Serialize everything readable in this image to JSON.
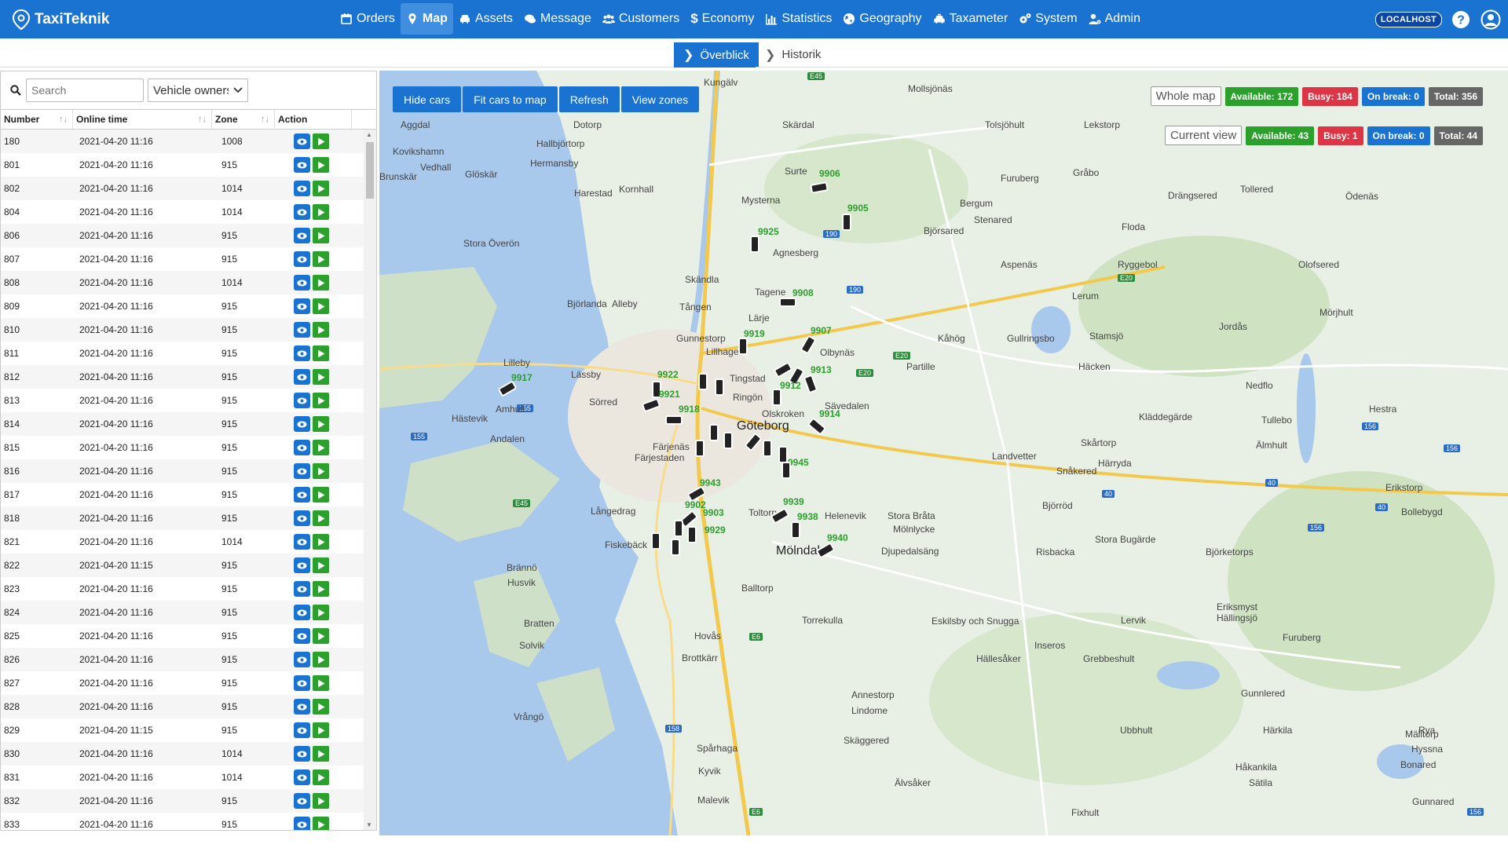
{
  "nav": {
    "brand": "TaxiTeknik",
    "items": [
      {
        "label": "Orders",
        "icon": "calendar-icon",
        "active": false
      },
      {
        "label": "Map",
        "icon": "map-pin-icon",
        "active": true
      },
      {
        "label": "Assets",
        "icon": "car-icon",
        "active": false
      },
      {
        "label": "Message",
        "icon": "chat-icon",
        "active": false
      },
      {
        "label": "Customers",
        "icon": "users-icon",
        "active": false
      },
      {
        "label": "Economy",
        "icon": "dollar-icon",
        "active": false
      },
      {
        "label": "Statistics",
        "icon": "bar-chart-icon",
        "active": false
      },
      {
        "label": "Geography",
        "icon": "globe-icon",
        "active": false
      },
      {
        "label": "Taxameter",
        "icon": "taxi-icon",
        "active": false
      },
      {
        "label": "System",
        "icon": "cogs-icon",
        "active": false
      },
      {
        "label": "Admin",
        "icon": "user-cog-icon",
        "active": false
      }
    ],
    "host_badge": "LOCALHOST"
  },
  "subnav": {
    "overview": "Överblick",
    "history": "Historik"
  },
  "vehicles": {
    "search_placeholder": "Search",
    "owner_select": "Vehicle owners",
    "columns": [
      "Number",
      "Online time",
      "Zone",
      "Action"
    ],
    "rows": [
      {
        "number": "180",
        "time": "2021-04-20 11:16",
        "zone": "1008"
      },
      {
        "number": "801",
        "time": "2021-04-20 11:16",
        "zone": "915"
      },
      {
        "number": "802",
        "time": "2021-04-20 11:16",
        "zone": "1014"
      },
      {
        "number": "804",
        "time": "2021-04-20 11:16",
        "zone": "1014"
      },
      {
        "number": "806",
        "time": "2021-04-20 11:16",
        "zone": "915"
      },
      {
        "number": "807",
        "time": "2021-04-20 11:16",
        "zone": "915"
      },
      {
        "number": "808",
        "time": "2021-04-20 11:16",
        "zone": "1014"
      },
      {
        "number": "809",
        "time": "2021-04-20 11:16",
        "zone": "915"
      },
      {
        "number": "810",
        "time": "2021-04-20 11:16",
        "zone": "915"
      },
      {
        "number": "811",
        "time": "2021-04-20 11:16",
        "zone": "915"
      },
      {
        "number": "812",
        "time": "2021-04-20 11:16",
        "zone": "915"
      },
      {
        "number": "813",
        "time": "2021-04-20 11:16",
        "zone": "915"
      },
      {
        "number": "814",
        "time": "2021-04-20 11:16",
        "zone": "915"
      },
      {
        "number": "815",
        "time": "2021-04-20 11:16",
        "zone": "915"
      },
      {
        "number": "816",
        "time": "2021-04-20 11:16",
        "zone": "915"
      },
      {
        "number": "817",
        "time": "2021-04-20 11:16",
        "zone": "915"
      },
      {
        "number": "818",
        "time": "2021-04-20 11:16",
        "zone": "915"
      },
      {
        "number": "821",
        "time": "2021-04-20 11:16",
        "zone": "1014"
      },
      {
        "number": "822",
        "time": "2021-04-20 11:15",
        "zone": "915"
      },
      {
        "number": "823",
        "time": "2021-04-20 11:16",
        "zone": "915"
      },
      {
        "number": "824",
        "time": "2021-04-20 11:16",
        "zone": "915"
      },
      {
        "number": "825",
        "time": "2021-04-20 11:16",
        "zone": "915"
      },
      {
        "number": "826",
        "time": "2021-04-20 11:16",
        "zone": "915"
      },
      {
        "number": "827",
        "time": "2021-04-20 11:16",
        "zone": "915"
      },
      {
        "number": "828",
        "time": "2021-04-20 11:16",
        "zone": "915"
      },
      {
        "number": "829",
        "time": "2021-04-20 11:15",
        "zone": "915"
      },
      {
        "number": "830",
        "time": "2021-04-20 11:16",
        "zone": "1014"
      },
      {
        "number": "831",
        "time": "2021-04-20 11:16",
        "zone": "1014"
      },
      {
        "number": "832",
        "time": "2021-04-20 11:16",
        "zone": "915"
      },
      {
        "number": "833",
        "time": "2021-04-20 11:16",
        "zone": "915"
      }
    ]
  },
  "map": {
    "buttons": [
      "Hide cars",
      "Fit cars to map",
      "Refresh",
      "View zones"
    ],
    "whole_map": {
      "label": "Whole map",
      "available": "Available: 172",
      "busy": "Busy: 184",
      "on_break": "On break: 0",
      "total": "Total: 356"
    },
    "current_view": {
      "label": "Current view",
      "available": "Available: 43",
      "busy": "Busy: 1",
      "on_break": "On break: 0",
      "total": "Total: 44"
    },
    "places": [
      "Kungälv",
      "Mollsjönäs",
      "Aggdal",
      "Dotorp",
      "Skärdal",
      "Tolsjöhult",
      "Lekstorp",
      "Kovikshamn",
      "Hallbjörtorp",
      "Vedhall",
      "Hermansby",
      "Brunskär",
      "Glöskär",
      "Harestad",
      "Kornhall",
      "Surte",
      "Furuberg",
      "Gråbo",
      "Drängsered",
      "Tollered",
      "Ödenäs",
      "Mysterna",
      "Bergum",
      "Stenared",
      "Björsared",
      "Stora Överön",
      "Agnesberg",
      "Floda",
      "Aspenäs",
      "Ryggebol",
      "Olofsered",
      "Skändla",
      "Tagene",
      "Lerum",
      "Björlanda",
      "Alleby",
      "Tången",
      "Lärje",
      "Gunnestorp",
      "Olbynäs",
      "Kåhög",
      "Gullringsbo",
      "Stamsjö",
      "Jordås",
      "Mörjhult",
      "Lillhage",
      "Lilleby",
      "Lässby",
      "Tingstad",
      "Partille",
      "Häcken",
      "Sörred",
      "Amhult",
      "Ringön",
      "Sävedalen",
      "Nedflo",
      "Hästevik",
      "Olskroken",
      "Kläddegärde",
      "Tullebo",
      "Hestra",
      "Göteborg",
      "Andalen",
      "Färjenäs",
      "Färjestaden",
      "Landvetter",
      "Skårtorp",
      "Älmhult",
      "Härryda",
      "Snåkered",
      "Björröd",
      "Erikstorp",
      "Långedrag",
      "Toltorp",
      "Helenevik",
      "Stora Bråta",
      "Mölnlycke",
      "Bollebygd",
      "Fiskebäck",
      "Mölndal",
      "Djupedalsäng",
      "Risbacka",
      "Stora Bugärde",
      "Björketorps",
      "Brännö",
      "Husvik",
      "Balltorp",
      "Bratten",
      "Eriksmyst",
      "Hällingsjö",
      "Solvik",
      "Torrekulla",
      "Lervik",
      "Furuberg",
      "Eskilsby och Snugga",
      "Inseros",
      "Hovås",
      "Brottkärr",
      "Hällesåker",
      "Grebbeshult",
      "Gunnlered",
      "Vrångö",
      "Annestorp",
      "Lindome",
      "Ubbhult",
      "Härkila",
      "Mälltorp",
      "Rya",
      "Hyssna",
      "Spårhaga",
      "Skäggered",
      "Bonared",
      "Kyvik",
      "Håkankila",
      "Sätila",
      "Malevik",
      "Älvsåker",
      "Fixhult",
      "Gunnared"
    ],
    "car_labels": [
      "9906",
      "9905",
      "9925",
      "9908",
      "9907",
      "9919",
      "9913",
      "9922",
      "9921",
      "9917",
      "9918",
      "9912",
      "9914",
      "9945",
      "9943",
      "9902",
      "9903",
      "9939",
      "9938",
      "9940",
      "9929"
    ]
  }
}
